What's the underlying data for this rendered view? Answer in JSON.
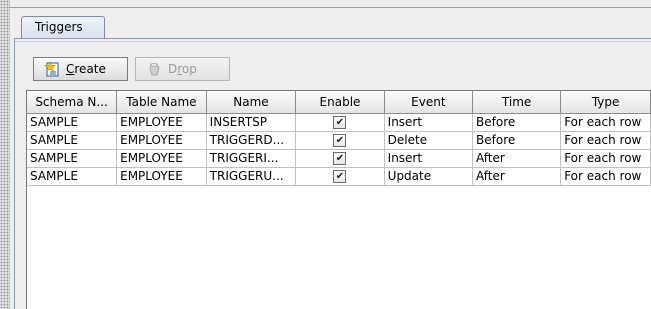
{
  "tab": {
    "label": "Triggers"
  },
  "toolbar": {
    "create_prefix": "",
    "create_u": "C",
    "create_rest": "reate",
    "drop_prefix": "D",
    "drop_u": "r",
    "drop_rest": "op",
    "create_icon": "create-trigger-icon",
    "drop_icon": "drop-trigger-icon"
  },
  "table": {
    "headers": [
      "Schema N...",
      "Table Name",
      "Name",
      "Enable",
      "Event",
      "Time",
      "Type"
    ],
    "rows": [
      {
        "schema": "SAMPLE",
        "table": "EMPLOYEE",
        "name": "INSERTSP",
        "enable": "✔",
        "event": "Insert",
        "time": "Before",
        "type": "For each row"
      },
      {
        "schema": "SAMPLE",
        "table": "EMPLOYEE",
        "name": "TRIGGERD...",
        "enable": "✔",
        "event": "Delete",
        "time": "Before",
        "type": "For each row"
      },
      {
        "schema": "SAMPLE",
        "table": "EMPLOYEE",
        "name": "TRIGGERI...",
        "enable": "✔",
        "event": "Insert",
        "time": "After",
        "type": "For each row"
      },
      {
        "schema": "SAMPLE",
        "table": "EMPLOYEE",
        "name": "TRIGGERU...",
        "enable": "✔",
        "event": "Update",
        "time": "After",
        "type": "For each row"
      }
    ]
  },
  "colors": {
    "tab_border": "#7e8aa0",
    "header_bg": "#e4e4e4",
    "grid": "#c0c0c0"
  }
}
